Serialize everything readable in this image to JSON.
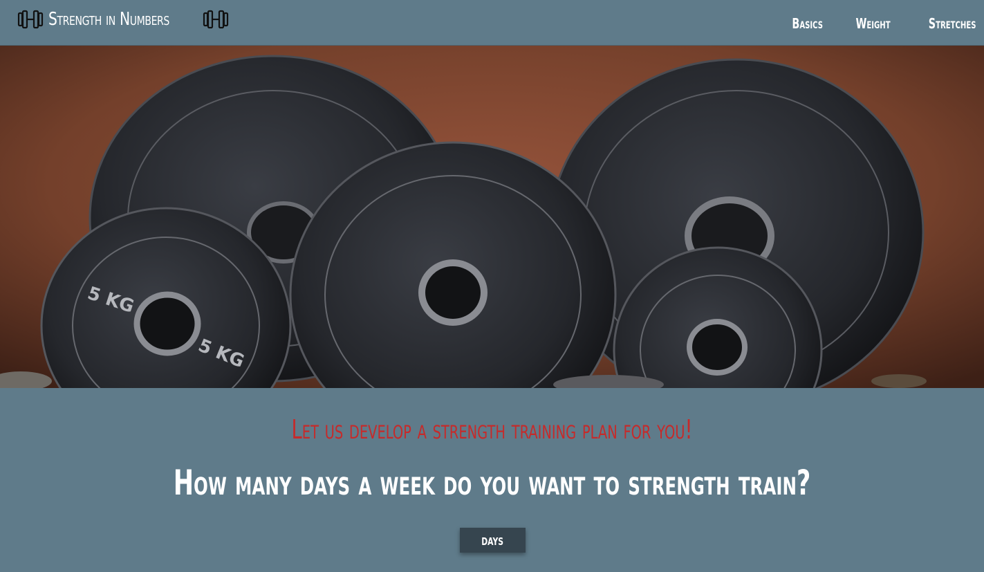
{
  "header": {
    "brand": "Strength in Numbers",
    "left_icon": "dumbbell-icon",
    "right_icon": "dumbbell-icon",
    "nav": [
      {
        "label": "Basics"
      },
      {
        "label": "Weight"
      },
      {
        "label": "Stretches"
      }
    ]
  },
  "hero": {
    "image": "weight-plates-photo",
    "plate_labels": [
      "5 KG",
      "5 KG"
    ]
  },
  "main": {
    "subtitle": "Let us develop a strength training plan for you!",
    "question": "How many days a week do you want to strength train?",
    "days_button": "days"
  },
  "colors": {
    "background": "#5f7b8a",
    "accent_red": "#c62a2a",
    "button": "#36454f",
    "text": "#ffffff"
  }
}
